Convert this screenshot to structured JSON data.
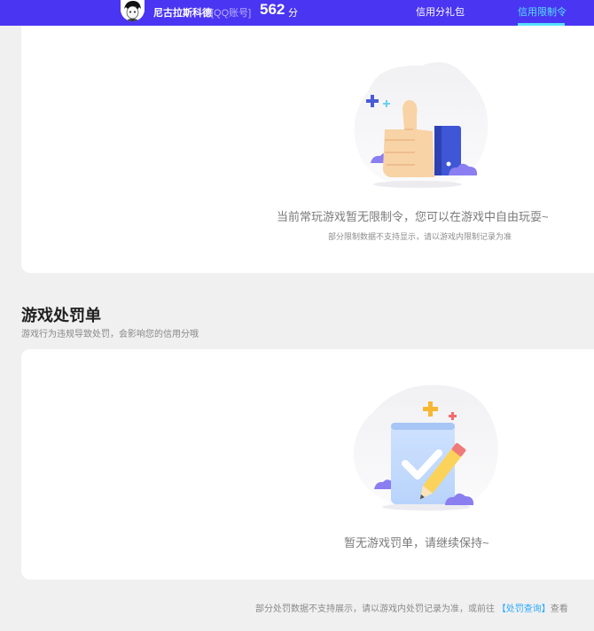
{
  "header": {
    "user_name": "尼古拉斯科德",
    "account_type": "[QQ账号]",
    "score": "562",
    "score_unit": "分",
    "tabs": [
      {
        "label": "信用分礼包",
        "active": false
      },
      {
        "label": "信用限制令",
        "active": true
      }
    ],
    "colors": {
      "bar": "#4a35f2",
      "active_tab": "#56e0ff"
    }
  },
  "restriction": {
    "message": "当前常玩游戏暂无限制令，您可以在游戏中自由玩耍~",
    "note": "部分限制数据不支持显示，请以游戏内限制记录为准",
    "illustration": "thumbs-up-illustration"
  },
  "penalty": {
    "title": "游戏处罚单",
    "subtitle": "游戏行为违规导致处罚，会影响您的信用分哦",
    "message": "暂无游戏罚单，请继续保持~",
    "illustration": "document-pencil-illustration"
  },
  "footer": {
    "text_before": "部分处罚数据不支持展示，请以游戏内处罚记录为准，或前往",
    "link": "【处罚查询】",
    "text_after": "查看"
  }
}
